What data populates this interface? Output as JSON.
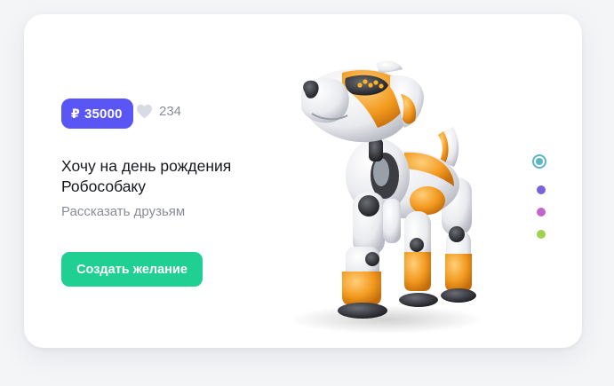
{
  "card": {
    "price": {
      "currency_symbol": "₽",
      "amount": "35000",
      "color": "#5a55f5"
    },
    "likes": {
      "count": "234",
      "icon": "heart-icon"
    },
    "title": "Хочу на день рождения Робособаку",
    "share_link": "Рассказать друзьям",
    "cta_label": "Создать желание",
    "cta_color": "#1fd092",
    "image": "robot-dog-image",
    "pagination": {
      "active_index": 0,
      "dots": [
        {
          "color": "#59b6c4"
        },
        {
          "color": "#7a62d8"
        },
        {
          "color": "#c166c8"
        },
        {
          "color": "#9fd151"
        }
      ]
    }
  }
}
